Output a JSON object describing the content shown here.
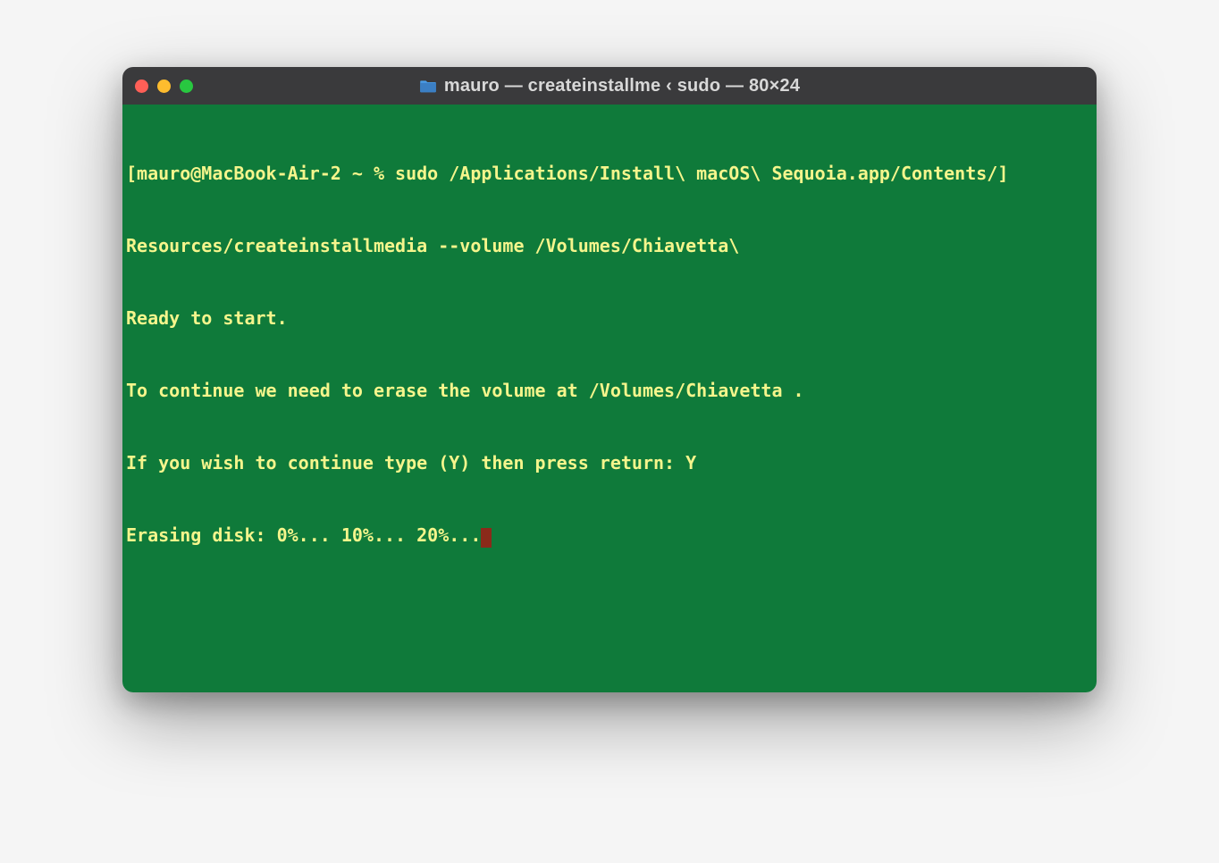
{
  "window": {
    "title": "mauro — createinstallme ‹ sudo — 80×24"
  },
  "terminal": {
    "line1_open_bracket": "[",
    "line1_prompt_cmd": "mauro@MacBook-Air-2 ~ % sudo /Applications/Install\\ macOS\\ Sequoia.app/Contents/",
    "line1_close_bracket": "]",
    "line2": "Resources/createinstallmedia --volume /Volumes/Chiavetta\\",
    "line3": "Ready to start.",
    "line4": "To continue we need to erase the volume at /Volumes/Chiavetta .",
    "line5": "If you wish to continue type (Y) then press return: Y",
    "line6": "Erasing disk: 0%... 10%... 20%..."
  }
}
